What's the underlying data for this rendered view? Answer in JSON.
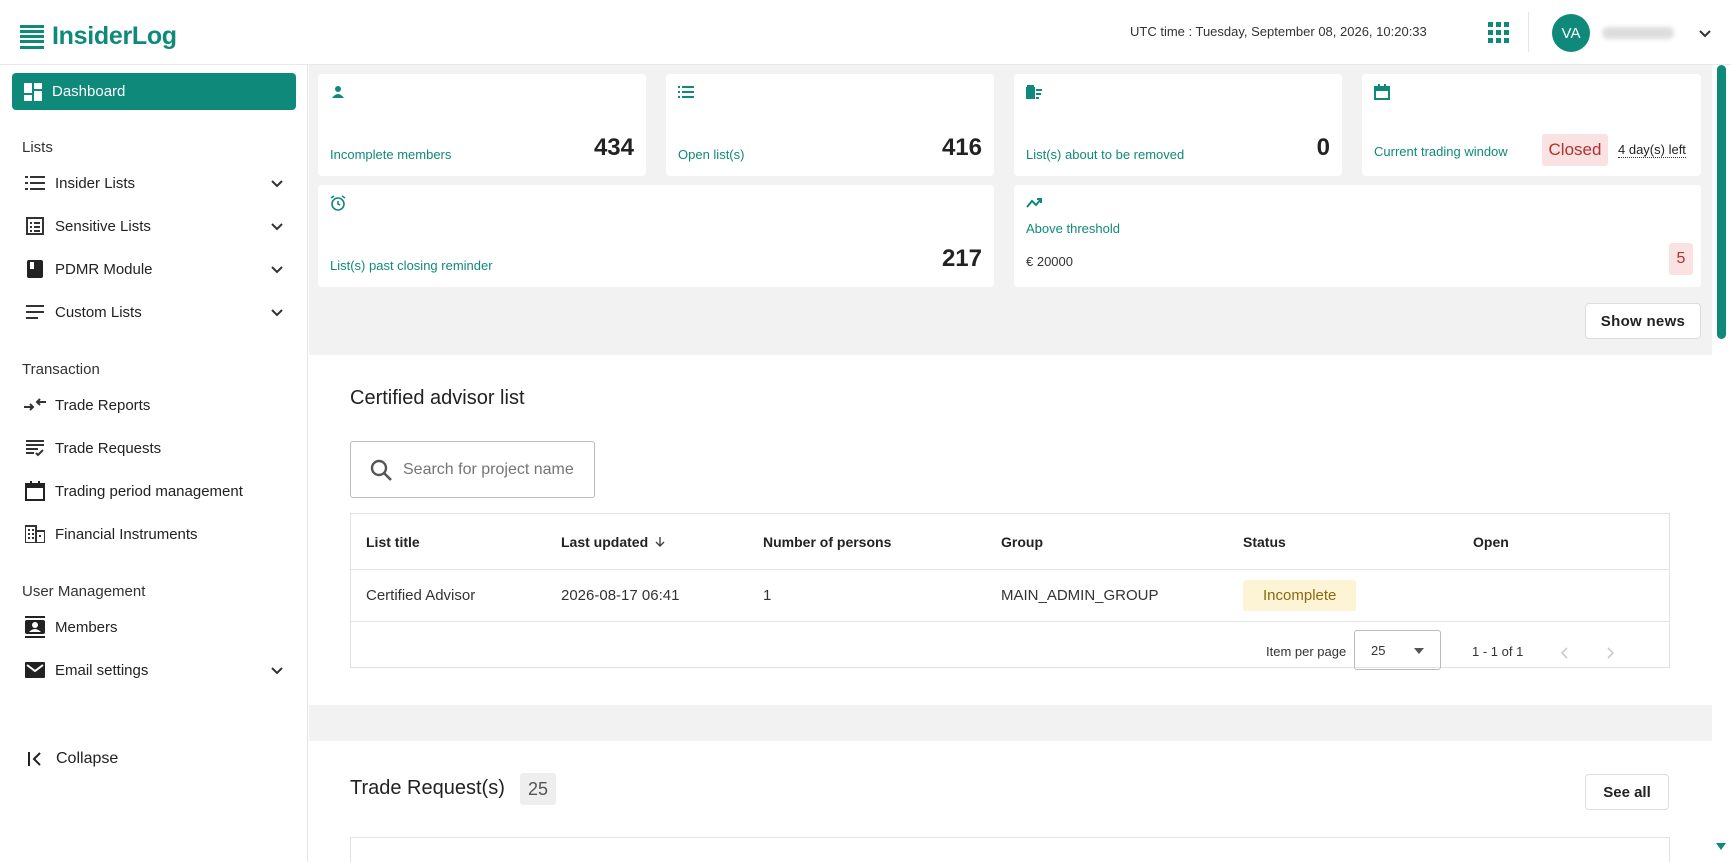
{
  "app": {
    "name": "InsiderLog",
    "utc_label": "UTC time : Tuesday, September 08, 2026, 10:20:33",
    "user_initials": "VA"
  },
  "colors": {
    "brand": "#0f8a7a",
    "danger_bg": "#fbe2e2",
    "warning_bg": "#fdf3d5"
  },
  "sidebar": {
    "dashboard": "Dashboard",
    "sections": {
      "lists": "Lists",
      "transaction": "Transaction",
      "user_management": "User Management"
    },
    "items": [
      {
        "label": "Insider Lists",
        "icon": "list-icon"
      },
      {
        "label": "Sensitive Lists",
        "icon": "checklist-icon"
      },
      {
        "label": "PDMR Module",
        "icon": "book-icon"
      },
      {
        "label": "Custom Lists",
        "icon": "lines-icon"
      },
      {
        "label": "Trade Reports",
        "icon": "swap-icon"
      },
      {
        "label": "Trade Requests",
        "icon": "request-icon"
      },
      {
        "label": "Trading period management",
        "icon": "calendar-icon"
      },
      {
        "label": "Financial Instruments",
        "icon": "building-icon"
      },
      {
        "label": "Members",
        "icon": "contacts-icon"
      },
      {
        "label": "Email settings",
        "icon": "mail-icon"
      }
    ],
    "collapse": "Collapse"
  },
  "stats": {
    "incomplete_members": {
      "label": "Incomplete members",
      "value": "434"
    },
    "open_lists": {
      "label": "Open list(s)",
      "value": "416"
    },
    "about_removed": {
      "label": "List(s) about to be removed",
      "value": "0"
    },
    "trading_window": {
      "label": "Current trading window",
      "status": "Closed",
      "days_left": "4 day(s) left"
    },
    "past_reminder": {
      "label": "List(s) past closing reminder",
      "value": "217"
    },
    "threshold": {
      "label": "Above threshold",
      "amount": "€ 20000",
      "value": "5"
    }
  },
  "show_news": "Show news",
  "certified": {
    "title": "Certified advisor list",
    "search_placeholder": "Search for project name",
    "columns": [
      "List title",
      "Last updated",
      "Number of persons",
      "Group",
      "Status",
      "Open"
    ],
    "rows": [
      {
        "title": "Certified Advisor",
        "updated": "2026-08-17 06:41",
        "persons": "1",
        "group": "MAIN_ADMIN_GROUP",
        "status": "Incomplete"
      }
    ],
    "pager": {
      "label": "Item per page",
      "per_page": "25",
      "range": "1 - 1 of 1"
    }
  },
  "trade_requests": {
    "title": "Trade Request(s)",
    "count": "25",
    "see_all": "See all"
  }
}
